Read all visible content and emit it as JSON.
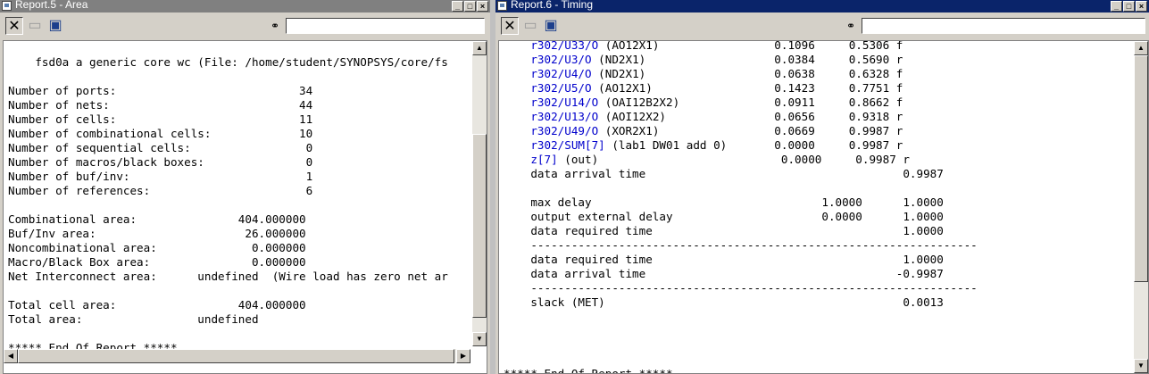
{
  "left_window": {
    "title": "Report.5 - Area",
    "lines": [
      "",
      "    fsd0a a generic core wc (File: /home/student/SYNOPSYS/core/fs",
      "",
      "Number of ports:                           34",
      "Number of nets:                            44",
      "Number of cells:                           11",
      "Number of combinational cells:             10",
      "Number of sequential cells:                 0",
      "Number of macros/black boxes:               0",
      "Number of buf/inv:                          1",
      "Number of references:                       6",
      "",
      "Combinational area:               404.000000",
      "Buf/Inv area:                      26.000000",
      "Noncombinational area:              0.000000",
      "Macro/Black Box area:               0.000000",
      "Net Interconnect area:      undefined  (Wire load has zero net ar",
      "",
      "Total cell area:                  404.000000",
      "Total area:                 undefined",
      "",
      "***** End Of Report *****"
    ]
  },
  "right_window": {
    "title": "Report.6 - Timing",
    "path_rows": [
      {
        "pin": "r302/U33/O",
        "rest": " (AO12X1)                 0.1096     0.5306 f"
      },
      {
        "pin": "r302/U3/O",
        "rest": " (ND2X1)                   0.0384     0.5690 r"
      },
      {
        "pin": "r302/U4/O",
        "rest": " (ND2X1)                   0.0638     0.6328 f"
      },
      {
        "pin": "r302/U5/O",
        "rest": " (AO12X1)                  0.1423     0.7751 f"
      },
      {
        "pin": "r302/U14/O",
        "rest": " (OAI12B2X2)              0.0911     0.8662 f"
      },
      {
        "pin": "r302/U13/O",
        "rest": " (AOI12X2)                0.0656     0.9318 r"
      },
      {
        "pin": "r302/U49/O",
        "rest": " (XOR2X1)                 0.0669     0.9987 r"
      },
      {
        "pin": "r302/SUM[7]",
        "rest": " (lab1 DW01 add 0)       0.0000     0.9987 r"
      },
      {
        "pin": "z[7]",
        "rest": " (out)                           0.0000     0.9987 r"
      }
    ],
    "lines": [
      "data arrival time                                      0.9987",
      "",
      "max delay                                  1.0000      1.0000",
      "output external delay                      0.0000      1.0000",
      "data required time                                     1.0000",
      "------------------------------------------------------------------",
      "data required time                                     1.0000",
      "data arrival time                                     -0.9987",
      "------------------------------------------------------------------",
      "slack (MET)                                            0.0013",
      "",
      "",
      "",
      "",
      "***** End Of Report *****"
    ]
  },
  "icons": {
    "close": "close-report-icon",
    "open": "open-folder-icon",
    "save": "save-floppy-icon",
    "find": "binoculars-find-icon"
  }
}
